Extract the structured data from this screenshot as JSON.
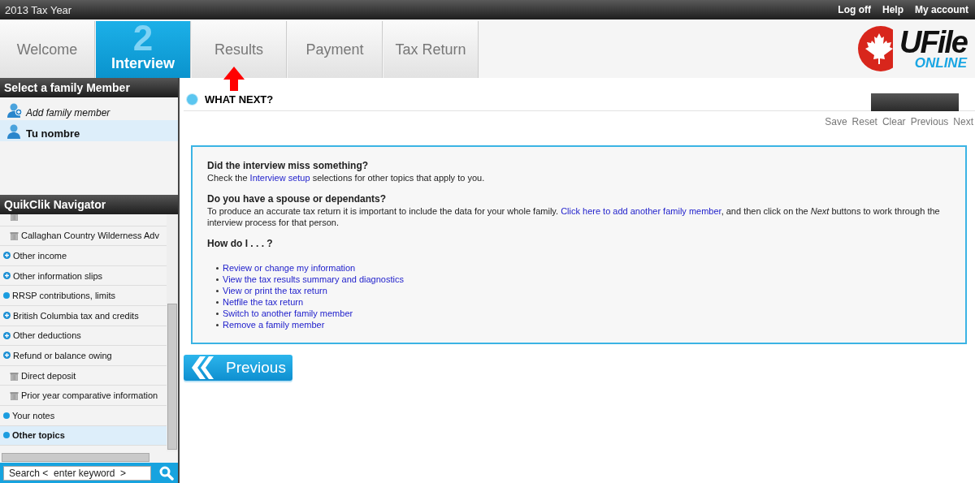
{
  "top_bar": {
    "title": "2013 Tax Year",
    "links": [
      "Log off",
      "Help",
      "My account"
    ]
  },
  "tabs": [
    {
      "label": "Welcome",
      "selected": false
    },
    {
      "label": "Interview",
      "selected": true,
      "number": "2"
    },
    {
      "label": "Results",
      "selected": false
    },
    {
      "label": "Payment",
      "selected": false
    },
    {
      "label": "Tax Return",
      "selected": false
    }
  ],
  "logo": {
    "name": "UFile",
    "tagline": "ONLINE"
  },
  "family_panel": {
    "title": "Select a family Member",
    "members": [
      {
        "kind": "add",
        "label": "Add family member",
        "selected": false
      },
      {
        "kind": "person",
        "label": "Tu nombre",
        "selected": true
      }
    ]
  },
  "navigator": {
    "title": "QuikClik Navigator",
    "items": [
      {
        "kind": "slip",
        "selected": false
      },
      {
        "kind": "slip",
        "label": "Callaghan Country Wilderness Adv",
        "selected": false
      },
      {
        "kind": "group",
        "label": "Other income",
        "selected": false
      },
      {
        "kind": "group",
        "label": "Other information slips",
        "selected": false
      },
      {
        "kind": "topic",
        "label": "RRSP contributions, limits",
        "selected": false
      },
      {
        "kind": "group",
        "label": "British Columbia tax and credits",
        "selected": false
      },
      {
        "kind": "group",
        "label": "Other deductions",
        "selected": false
      },
      {
        "kind": "group",
        "label": "Refund or balance owing",
        "selected": false
      },
      {
        "kind": "slip",
        "label": "Direct deposit",
        "selected": false
      },
      {
        "kind": "slip",
        "label": "Prior year comparative information",
        "selected": false
      },
      {
        "kind": "topic",
        "label": "Your notes",
        "selected": false
      },
      {
        "kind": "topic",
        "label": "Other topics",
        "selected": true
      }
    ],
    "search": {
      "placeholder": "Search <  enter keyword  >"
    }
  },
  "page": {
    "title": "WHAT NEXT?",
    "actions": [
      "Save",
      "Reset",
      "Clear",
      "Previous",
      "Next"
    ],
    "sections": [
      {
        "heading": "Did the interview miss something?",
        "parts": [
          {
            "kind": "text",
            "text": "Check the "
          },
          {
            "kind": "link",
            "text": "Interview setup"
          },
          {
            "kind": "text",
            "text": " selections for other topics that apply to you."
          }
        ]
      },
      {
        "heading": "Do you have a spouse or dependants?",
        "parts": [
          {
            "kind": "text",
            "text": "To produce an accurate tax return it is important to include the data for your whole family. "
          },
          {
            "kind": "link",
            "text": "Click here to add another family member"
          },
          {
            "kind": "text",
            "text": ", and then click on the *Next* buttons to work through the interview process for that person."
          }
        ]
      },
      {
        "heading": "How do I . . . ?",
        "links": [
          "Review or change my information",
          "View the tax results summary and diagnostics",
          "View or print the tax return",
          "Netfile the tax return",
          "Switch to another family member",
          "Remove a family member"
        ]
      }
    ],
    "previous_button": "Previous"
  }
}
